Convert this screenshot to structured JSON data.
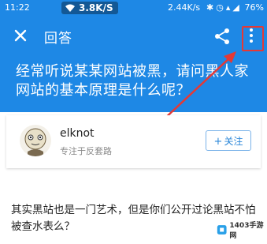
{
  "status_bar": {
    "time": "11:22",
    "network_speed_badge": "3.8K/S",
    "speed_text": "2.44K/s",
    "battery": "76%"
  },
  "toolbar": {
    "title": "回答"
  },
  "question": {
    "title": "经常听说某某网站被黑，请问黑人家网站的基本原理是什么呢？"
  },
  "author": {
    "name": "elknot",
    "description": "专注于反套路",
    "follow_label": "关注"
  },
  "answer": {
    "text": "其实黑站也是一门艺术，但是你们公开过论黑站不怕被查水表么？"
  },
  "watermark": {
    "text": "1403手游网"
  },
  "colors": {
    "header": "#1e88e5",
    "highlight": "#e53935",
    "follow": "#2b87d8"
  }
}
